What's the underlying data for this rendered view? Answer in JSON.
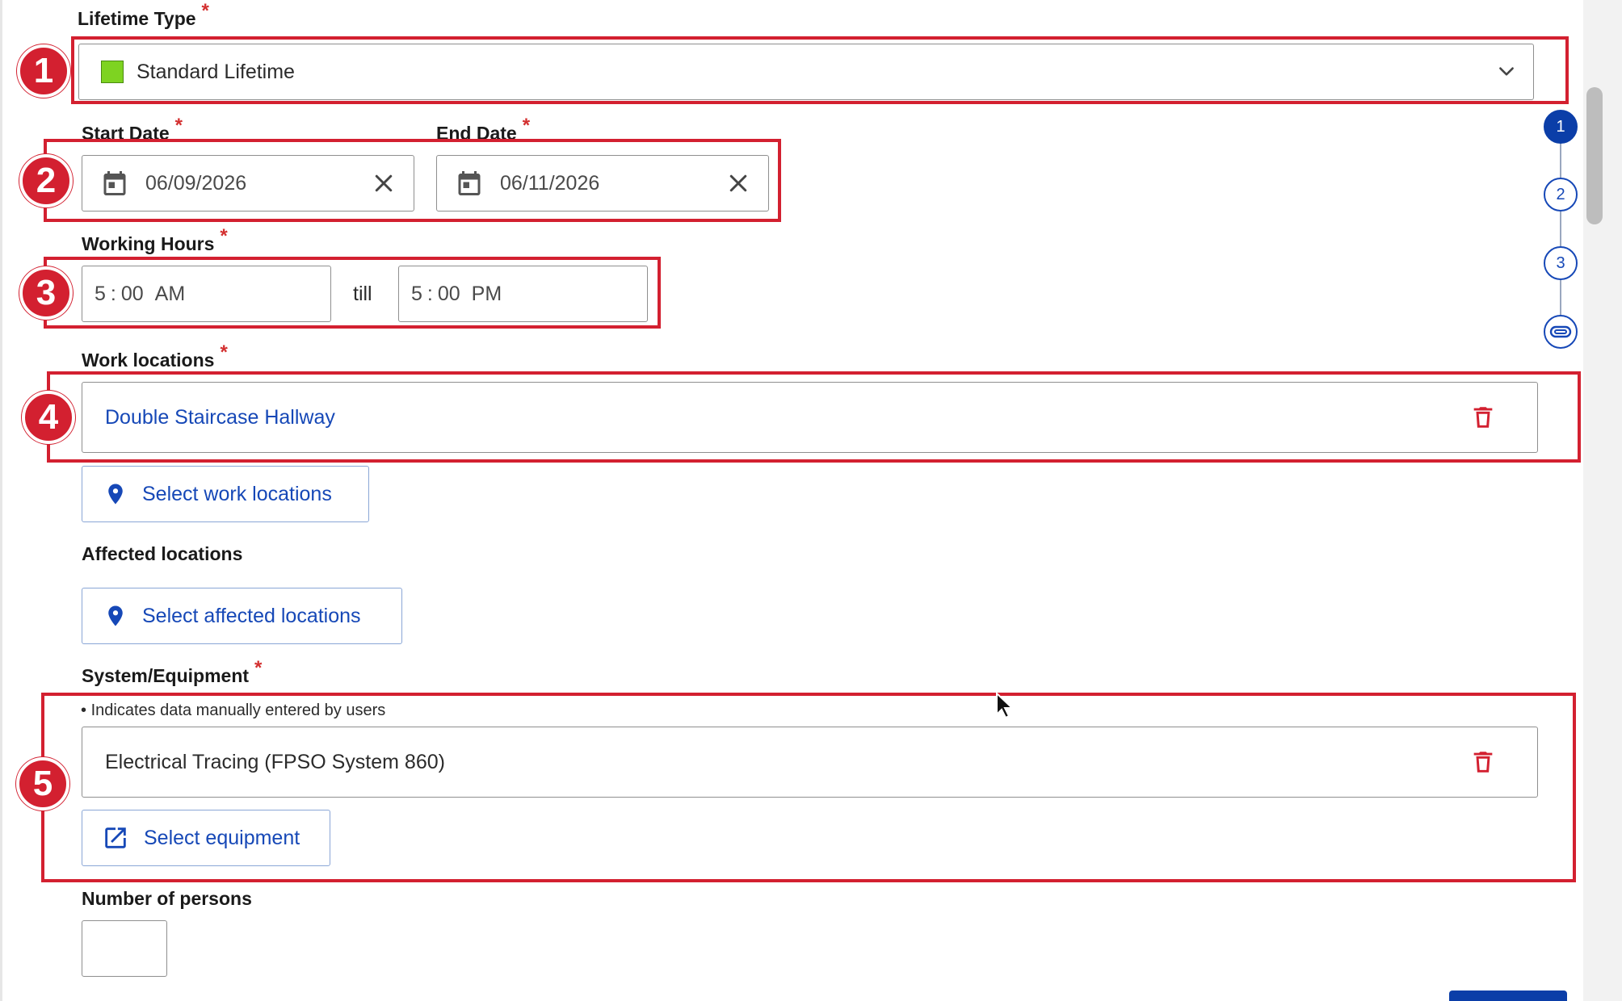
{
  "lifetime_type": {
    "label": "Lifetime Type",
    "required_mark": "*",
    "value": "Standard Lifetime",
    "swatch_color": "#7ed321"
  },
  "dates": {
    "start_label": "Start Date",
    "start_value": "06/09/2026",
    "end_label": "End Date",
    "end_value": "06/11/2026",
    "required_mark": "*"
  },
  "working_hours": {
    "label": "Working Hours",
    "required_mark": "*",
    "from": {
      "hour": "5",
      "sep": ":",
      "minute": "00",
      "ampm": "AM"
    },
    "separator": "till",
    "to": {
      "hour": "5",
      "sep": ":",
      "minute": "00",
      "ampm": "PM"
    }
  },
  "work_locations": {
    "label": "Work locations",
    "required_mark": "*",
    "items": [
      "Double Staircase Hallway"
    ],
    "select_button": "Select work locations"
  },
  "affected_locations": {
    "label": "Affected locations",
    "select_button": "Select affected locations"
  },
  "system_equipment": {
    "label": "System/Equipment",
    "required_mark": "*",
    "note_bullet": "•",
    "note": "Indicates data manually entered by users",
    "items": [
      "Electrical Tracing (FPSO System 860)"
    ],
    "select_button": "Select equipment"
  },
  "number_of_persons": {
    "label": "Number of persons",
    "value": ""
  },
  "stepper": {
    "steps": [
      "1",
      "2",
      "3"
    ],
    "active_step": "1",
    "last_icon": "paperclip-icon"
  },
  "annotations": [
    "1",
    "2",
    "3",
    "4",
    "5"
  ],
  "colors": {
    "accent": "#1648b7",
    "annotation": "#d32030",
    "required": "#d32f2f",
    "delete_icon": "#d32030"
  }
}
